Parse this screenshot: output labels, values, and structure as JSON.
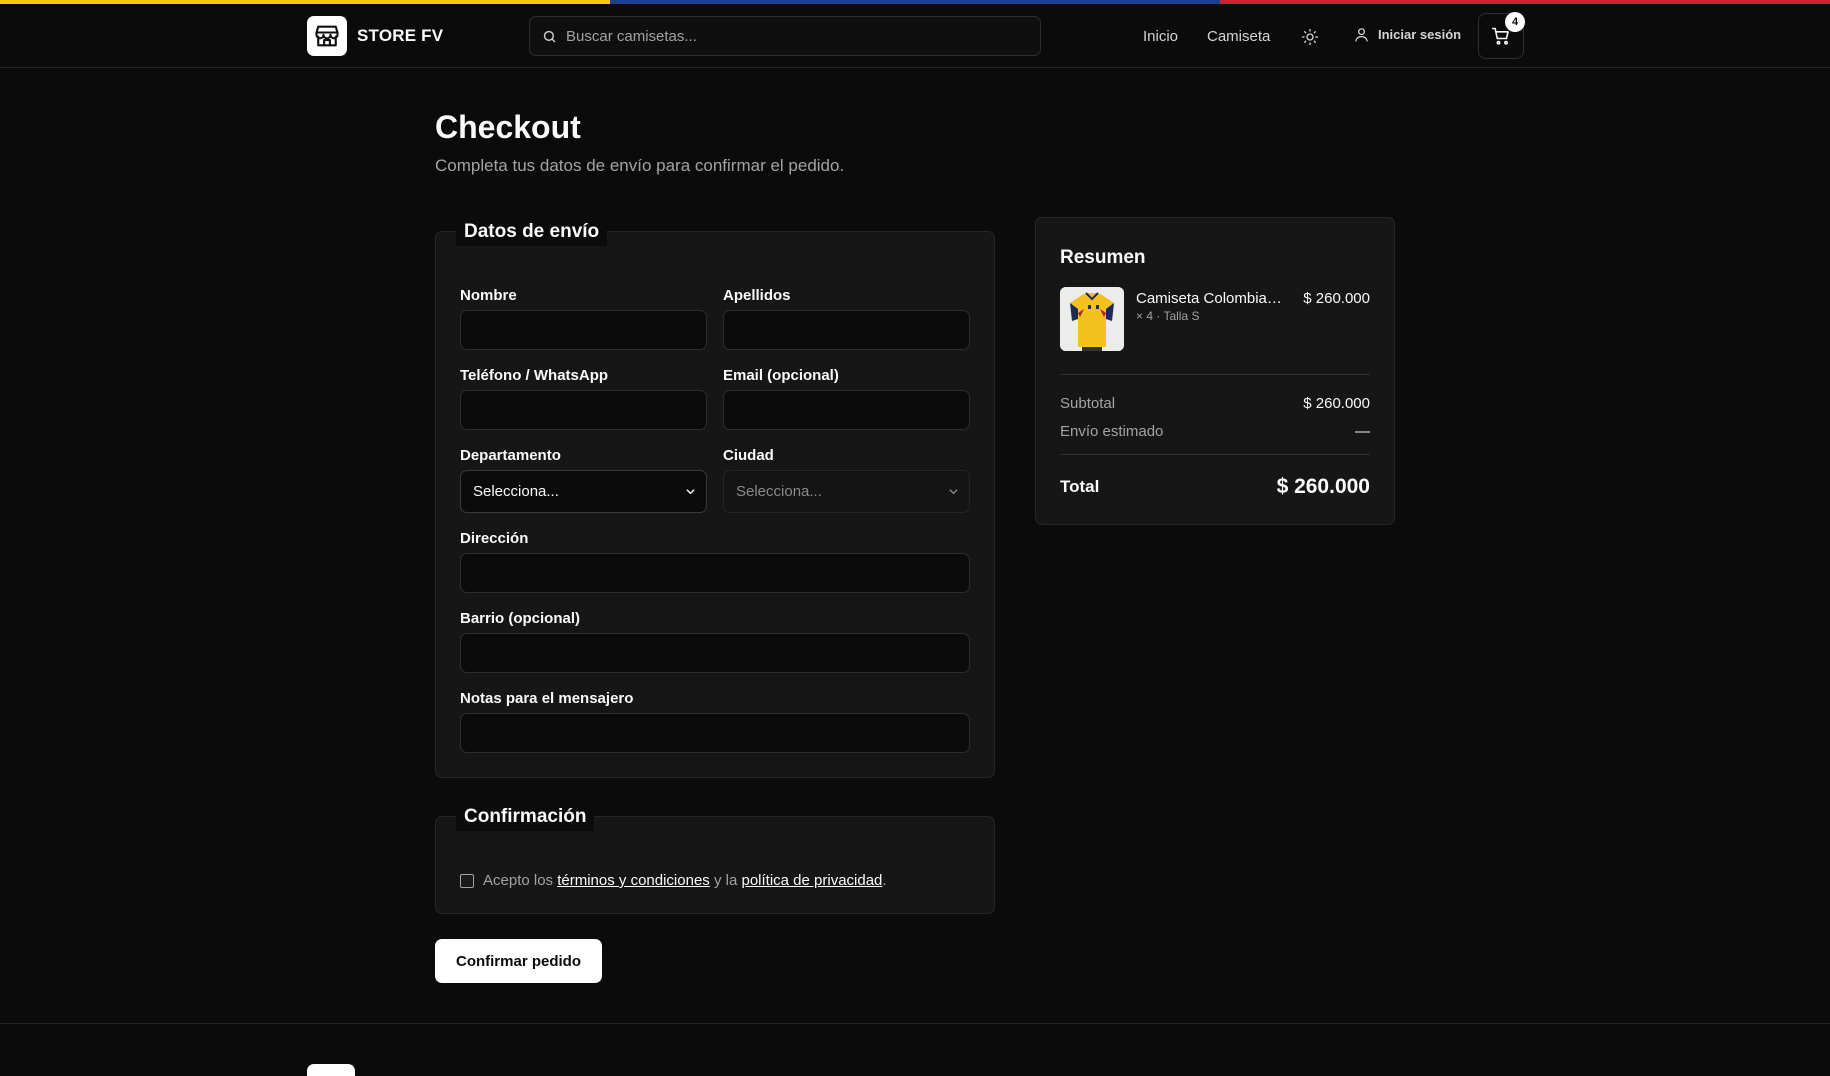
{
  "header": {
    "brand": "STORE FV",
    "search_placeholder": "Buscar camisetas...",
    "nav": [
      "Inicio",
      "Camiseta"
    ],
    "login_label": "Iniciar sesión",
    "cart_count": "4"
  },
  "page": {
    "title": "Checkout",
    "subtitle": "Completa tus datos de envío para confirmar el pedido."
  },
  "shipping": {
    "legend": "Datos de envío",
    "fields": {
      "nombre": "Nombre",
      "apellidos": "Apellidos",
      "telefono": "Teléfono / WhatsApp",
      "email": "Email (opcional)",
      "departamento": "Departamento",
      "ciudad": "Ciudad",
      "direccion": "Dirección",
      "barrio": "Barrio (opcional)",
      "notas": "Notas para el mensajero"
    },
    "departamento_value": "Selecciona...",
    "ciudad_value": "Selecciona..."
  },
  "confirmation": {
    "legend": "Confirmación",
    "terms_prefix": "Acepto los",
    "terms_link": "términos y condiciones",
    "terms_middle": "y la",
    "privacy_link": "política de privacidad",
    "terms_suffix": "."
  },
  "confirm_button": "Confirmar pedido",
  "summary": {
    "title": "Resumen",
    "item": {
      "name": "Camiseta Colombia I...",
      "meta": "× 4 · Talla S",
      "price": "$ 260.000"
    },
    "subtotal_label": "Subtotal",
    "subtotal_value": "$ 260.000",
    "shipping_label": "Envío estimado",
    "shipping_value": "—",
    "total_label": "Total",
    "total_value": "$ 260.000"
  },
  "colors": {
    "flag_yellow": "#f6c90e",
    "flag_blue": "#1b3f94",
    "flag_red": "#d11f31",
    "background": "#0b0b0b",
    "card": "#161616"
  }
}
